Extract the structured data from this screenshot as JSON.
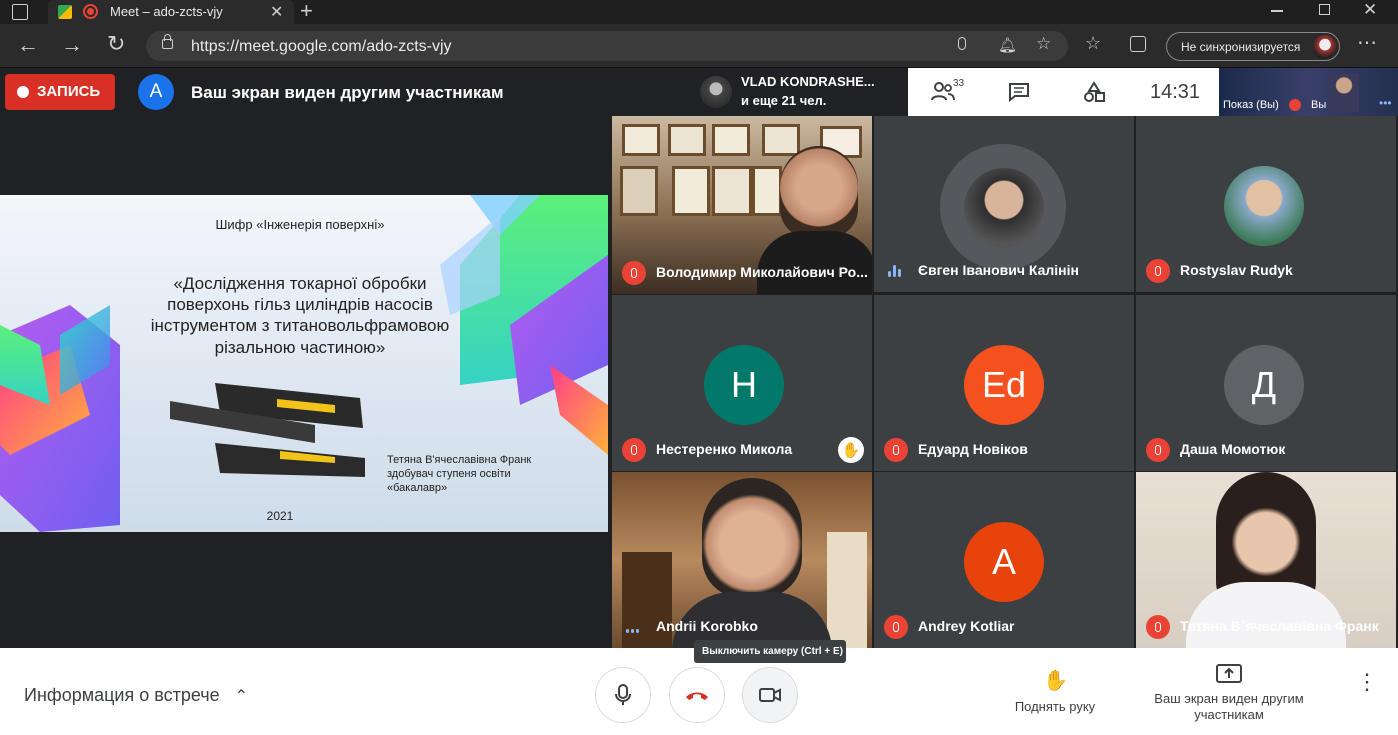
{
  "browser": {
    "tab_title": "Meet – ado-zcts-vjy",
    "url": "https://meet.google.com/ado-zcts-vjy",
    "sync_label": "Не синхронизируется"
  },
  "meet": {
    "record_label": "ЗАПИСЬ",
    "presenter_initial": "A",
    "share_notice": "Ваш экран виден другим участникам",
    "active_speaker_name": "VLAD KONDRASHE...",
    "active_speaker_more": "и еще 21 чел.",
    "participant_count": "33",
    "time": "14:31",
    "self_view_label": "Показ (Вы)",
    "self_label": "Вы"
  },
  "slide": {
    "cipher": "Шифр «Інженерія поверхні»",
    "title_line1": "«Дослідження токарної обробки",
    "title_line2": "поверхонь гільз циліндрів насосів",
    "title_line3": "інструментом з титановольфрамовою",
    "title_line4": "різальною частиною»",
    "author": "Тетяна В'ячеславівна Франк",
    "degree_line1": "здобувач ступеня освіти",
    "degree_line2": "«бакалавр»",
    "year": "2021"
  },
  "participants": [
    {
      "name": "Володимир Миколайович Ро...",
      "initial": "",
      "muted": true
    },
    {
      "name": "Євген Іванович Калінін",
      "initial": "",
      "muted": false
    },
    {
      "name": "Rostyslav Rudyk",
      "initial": "",
      "muted": true
    },
    {
      "name": "Нестеренко Микола",
      "initial": "Н",
      "muted": true,
      "color": "#00796b",
      "hand_raised": true
    },
    {
      "name": "Едуард Новіков",
      "initial": "Ed",
      "muted": true,
      "color": "#f4511e"
    },
    {
      "name": "Даша Момотюк",
      "initial": "Д",
      "muted": true,
      "color": "#5f6368"
    },
    {
      "name": "Andrii Korobko",
      "initial": "",
      "muted": false
    },
    {
      "name": "Andrey Kotliar",
      "initial": "A",
      "muted": true,
      "color": "#e8430b"
    },
    {
      "name": "Тетяна В`ячеславівна Франк",
      "initial": "",
      "muted": true
    }
  ],
  "bottom": {
    "meeting_info": "Информация о встрече",
    "camera_tooltip": "Выключить камеру (Ctrl + E)",
    "raise_hand": "Поднять руку",
    "present_line1": "Ваш экран виден другим",
    "present_line2": "участникам"
  },
  "colors": {
    "record": "#d93025",
    "accent": "#1a73e8",
    "muted": "#ea4335",
    "end_call": "#d93025"
  }
}
